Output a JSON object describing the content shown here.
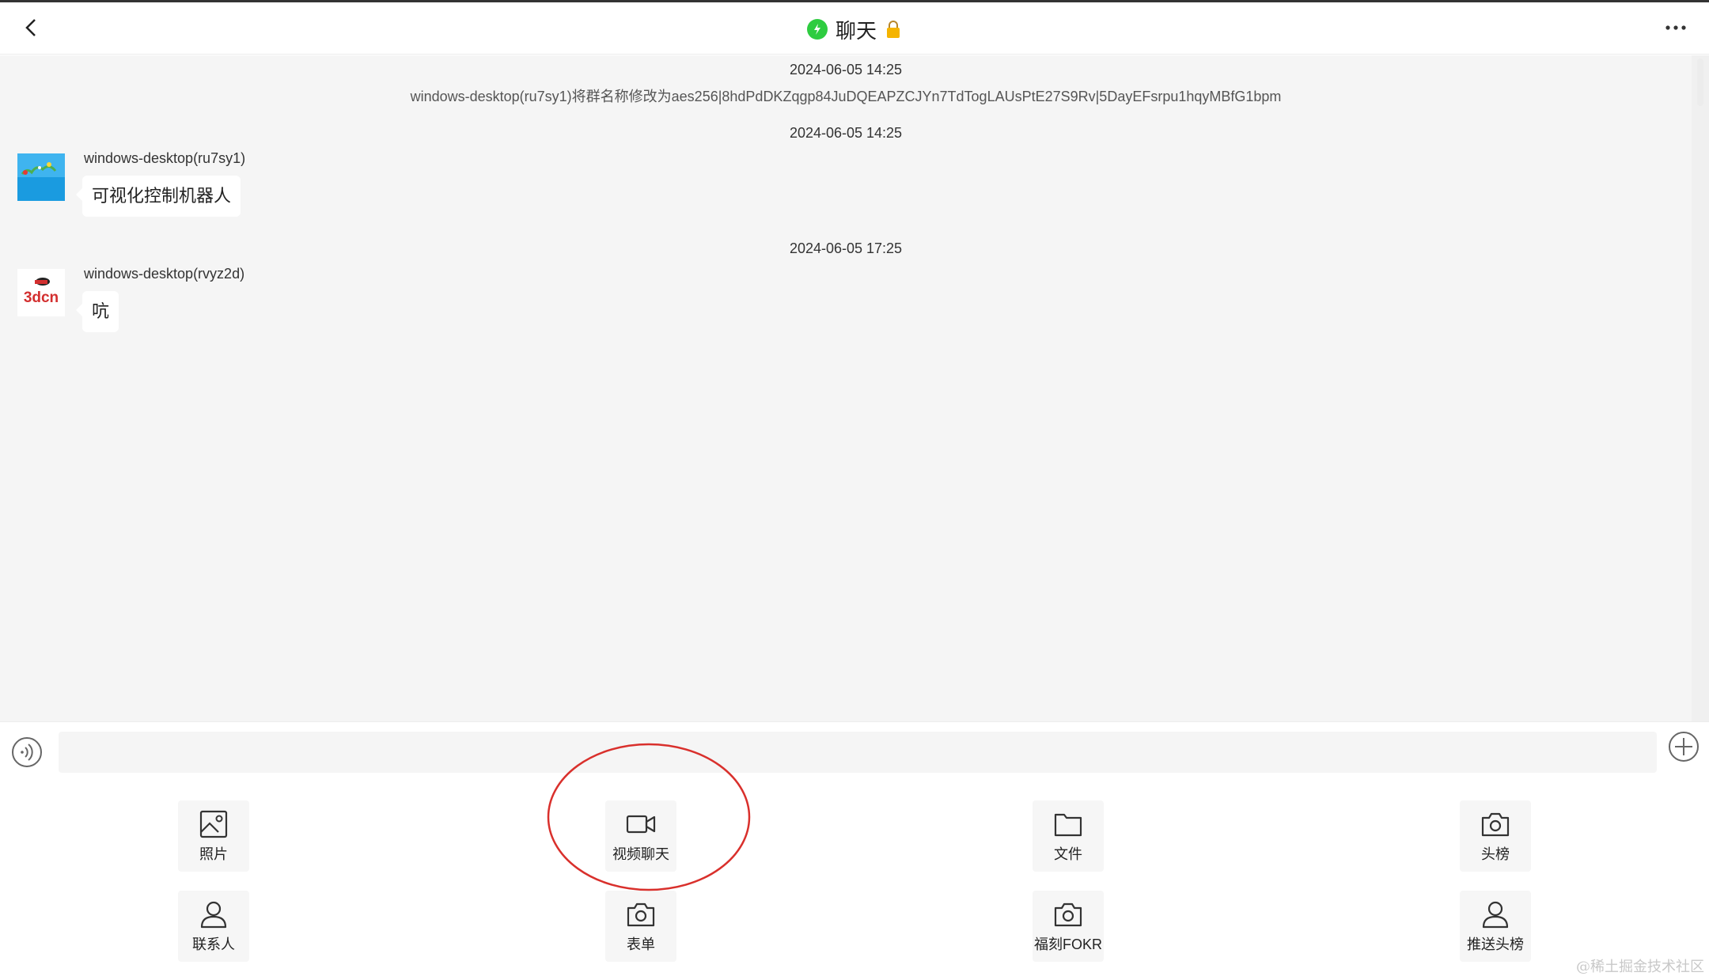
{
  "header": {
    "title": "聊天",
    "back_icon": "chevron-left-icon",
    "status_icon": "online-status-icon",
    "lock_icon": "lock-icon",
    "more_icon": "more-dots-icon",
    "status_color": "#2ecc40",
    "lock_color": "#f5b400"
  },
  "messages": {
    "ts1": "2024-06-05 14:25",
    "system_notice": "windows-desktop(ru7sy1)将群名称修改为aes256|8hdPdDKZqgp84JuDQEAPZCJYn7TdTogLAUsPtE27S9Rv|5DayEFsrpu1hqyMBfG1bpm",
    "ts2": "2024-06-05 14:25",
    "msg1": {
      "sender": "windows-desktop(ru7sy1)",
      "text": "可视化控制机器人"
    },
    "ts3": "2024-06-05 17:25",
    "msg2": {
      "sender": "windows-desktop(rvyz2d)",
      "text": "吭",
      "avatar_text": "3dcn"
    }
  },
  "input": {
    "value": "",
    "placeholder": "",
    "voice_icon": "voice-icon",
    "plus_icon": "plus-circle-icon"
  },
  "tools": {
    "photo": "照片",
    "video_chat": "视频聊天",
    "file": "文件",
    "headline": "头榜",
    "contacts": "联系人",
    "form": "表单",
    "fukr": "福刻FOKR",
    "push_headline": "推送头榜"
  },
  "annotation": {
    "color": "#d9302c"
  },
  "watermark": "@稀土掘金技术社区"
}
